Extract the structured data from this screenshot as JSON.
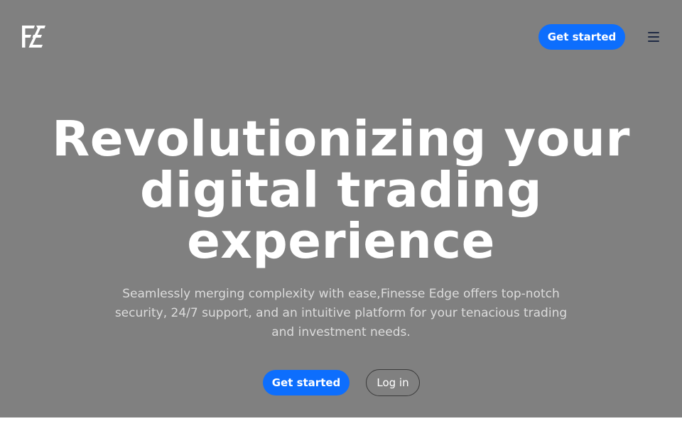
{
  "colors": {
    "hero_background": "#808080",
    "accent": "#0d6efd",
    "heading": "#ffffff",
    "subtitle": "#dcdcdc",
    "menu_icon": "#1f2a44"
  },
  "header": {
    "logo_icon": "finesse-edge-logo-icon",
    "cta_label": "Get started",
    "menu_icon": "hamburger-menu-icon"
  },
  "hero": {
    "title_lines": [
      "Revolutionizing your",
      "digital trading",
      "experience"
    ],
    "subtitle": "Seamlessly merging complexity with ease,Finesse Edge offers top-notch security, 24/7 support, and an intuitive platform for your tenacious trading and investment needs.",
    "primary_button": "Get started",
    "secondary_button": "Log in"
  }
}
